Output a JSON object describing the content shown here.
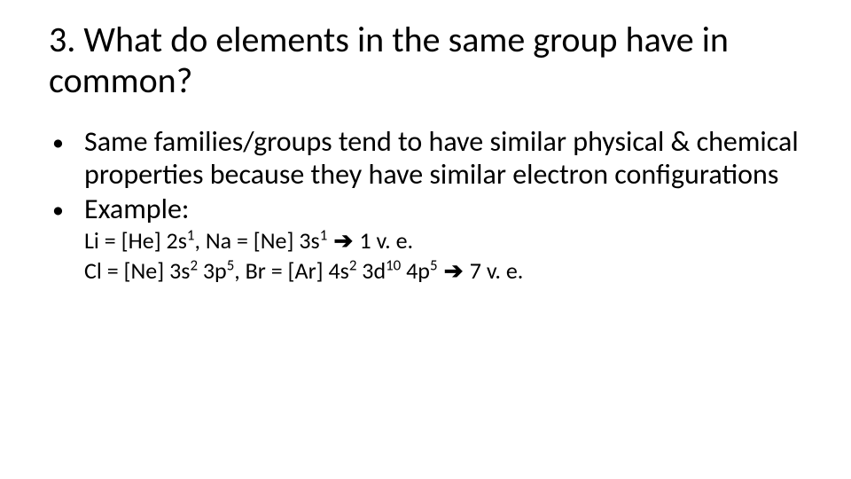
{
  "title": "3. What do elements in the same group have in common?",
  "bullets": [
    "Same families/groups tend to have similar physical & chemical properties because they have similar electron configurations",
    "Example:"
  ],
  "example_lines": {
    "line1": {
      "prefix": "Li = [He] 2s",
      "sup1": "1",
      "mid1": ", Na = [Ne] 3s",
      "sup2": "1",
      "arrow": " ➔ ",
      "tail": " 1 v. e."
    },
    "line2": {
      "p1": "Cl = [Ne] 3s",
      "s1": "2",
      "p2": " 3p",
      "s2": "5",
      "p3": ", Br = [Ar] 4s",
      "s3": "2",
      "p4": " 3d",
      "s4": "10",
      "p5": " 4p",
      "s5": "5",
      "arrow": " ➔ ",
      "tail": " 7 v. e."
    }
  }
}
